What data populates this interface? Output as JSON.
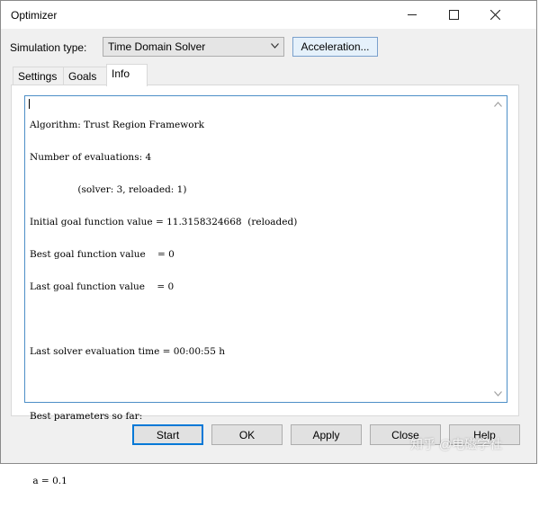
{
  "window": {
    "title": "Optimizer"
  },
  "simulation": {
    "label": "Simulation type:",
    "selected": "Time Domain Solver",
    "acceleration_label": "Acceleration..."
  },
  "tabs": [
    {
      "label": "Settings"
    },
    {
      "label": "Goals"
    },
    {
      "label": "Info",
      "active": true
    }
  ],
  "info": {
    "lines": [
      "Algorithm: Trust Region Framework",
      "Number of evaluations: 4",
      "                (solver: 3, reloaded: 1)",
      "Initial goal function value = 11.3158324668  (reloaded)",
      "Best goal function value    = 0",
      "Last goal function value    = 0",
      "",
      "Last solver evaluation time = 00:00:55 h",
      "",
      "Best parameters so far:",
      "",
      " a = 0.1"
    ]
  },
  "buttons": {
    "start": "Start",
    "ok": "OK",
    "apply": "Apply",
    "close": "Close",
    "help": "Help"
  },
  "watermark": "知乎 @电磁学社",
  "colors": {
    "accent": "#0078d7",
    "textbox_border": "#4d8fc7",
    "dialog_bg": "#f0f0f0"
  }
}
